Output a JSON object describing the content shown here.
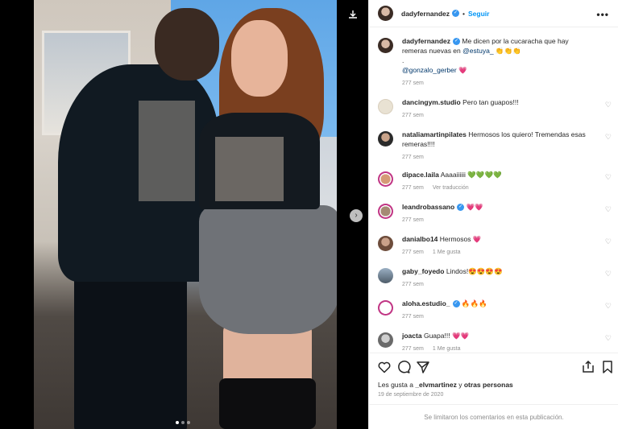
{
  "post": {
    "username": "dadyfernandez",
    "follow_label": "Seguir",
    "more_label": "•••",
    "caption": {
      "text": "Me dicen por la cucaracha que hay remeras nuevas en",
      "mention": "@estuya_",
      "emojis": "👏👏👏",
      "dot": ".",
      "mention2": "@gonzalo_gerber",
      "heart": "💗",
      "time": "277 sem"
    },
    "comments": [
      {
        "user": "dancingym.studio",
        "text": "Pero tan guapos!!!",
        "emoji": "",
        "time": "277 sem",
        "extra": "",
        "verified": false
      },
      {
        "user": "nataliamartinpilates",
        "text": "Hermosos los quiero! Tremendas esas remeras!!!!",
        "emoji": "",
        "time": "277 sem",
        "extra": "",
        "verified": false
      },
      {
        "user": "dipace.laila",
        "text": "Aaaaiiiiii",
        "emoji": "💚💚💚💚",
        "time": "277 sem",
        "extra": "Ver traducción",
        "verified": false
      },
      {
        "user": "leandrobassano",
        "text": "",
        "emoji": "💗💗",
        "time": "277 sem",
        "extra": "",
        "verified": true
      },
      {
        "user": "danialbo14",
        "text": "Hermosos",
        "emoji": "💗",
        "time": "277 sem",
        "extra": "1 Me gusta",
        "verified": false
      },
      {
        "user": "gaby_foyedo",
        "text": "Lindos!",
        "emoji": "😍😍😍😍",
        "time": "277 sem",
        "extra": "",
        "verified": false
      },
      {
        "user": "aloha.estudio_",
        "text": "",
        "emoji": "🔥🔥🔥",
        "time": "277 sem",
        "extra": "",
        "verified": true
      },
      {
        "user": "joacta",
        "text": "Guapa!!!",
        "emoji": "💗💗",
        "time": "277 sem",
        "extra": "1 Me gusta",
        "verified": false
      }
    ],
    "likes": {
      "prefix": "Les gusta a",
      "user": "_elvmartinez",
      "suffix": "y otras personas"
    },
    "date": "19 de septiembre de 2020",
    "comments_limited": "Se limitaron los comentarios en esta publicación."
  },
  "colors": {
    "accent": "#0095f6",
    "verified": "#3897f0",
    "muted": "#8e8e8e"
  }
}
